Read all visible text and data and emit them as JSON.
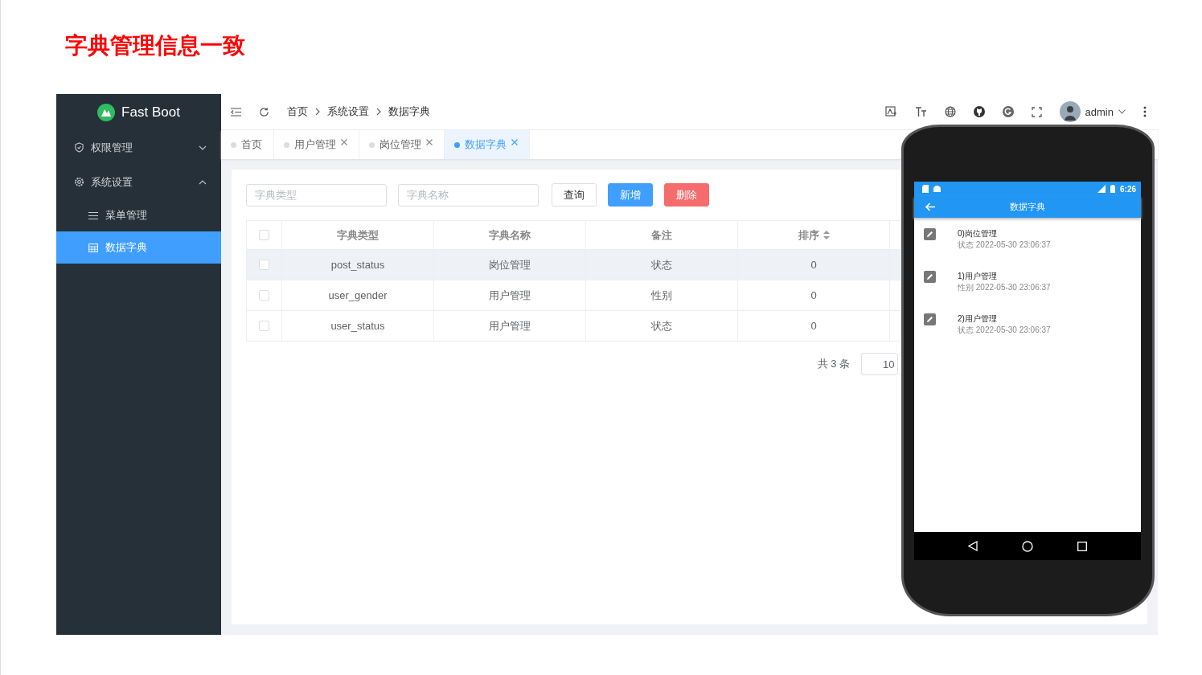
{
  "slide_title": "字典管理信息一致",
  "app": {
    "logo": "Fast Boot",
    "sidebar": [
      {
        "label": "权限管理",
        "expanded": false
      },
      {
        "label": "系统设置",
        "expanded": true,
        "children": [
          {
            "label": "菜单管理",
            "selected": false
          },
          {
            "label": "数据字典",
            "selected": true
          }
        ]
      }
    ],
    "breadcrumb": [
      "首页",
      "系统设置",
      "数据字典"
    ],
    "user": "admin",
    "tabs": [
      {
        "label": "首页",
        "selected": false,
        "closable": false
      },
      {
        "label": "用户管理",
        "selected": false,
        "closable": true
      },
      {
        "label": "岗位管理",
        "selected": false,
        "closable": true
      },
      {
        "label": "数据字典",
        "selected": true,
        "closable": true
      }
    ],
    "filters": [
      {
        "placeholder": "字典类型"
      },
      {
        "placeholder": "字典名称"
      }
    ],
    "buttons": [
      {
        "label": "查询",
        "kind": "default"
      },
      {
        "label": "新增",
        "kind": "primary"
      },
      {
        "label": "删除",
        "kind": "danger"
      }
    ],
    "table": {
      "header_checked": false,
      "columns": [
        {
          "label": "字典类型",
          "sortable": false
        },
        {
          "label": "字典名称",
          "sortable": false
        },
        {
          "label": "备注",
          "sortable": false
        },
        {
          "label": "排序",
          "sortable": true
        }
      ],
      "rows": [
        {
          "checked": false,
          "hovered": true,
          "cells": [
            "post_status",
            "岗位管理",
            "状态",
            "0"
          ]
        },
        {
          "checked": false,
          "hovered": false,
          "cells": [
            "user_gender",
            "用户管理",
            "性别",
            "0"
          ]
        },
        {
          "checked": false,
          "hovered": false,
          "cells": [
            "user_status",
            "用户管理",
            "状态",
            "0"
          ]
        }
      ]
    },
    "pagination": {
      "total": "共 3 条",
      "page_size": "10"
    }
  },
  "phone": {
    "time": "6:26",
    "title": "数据字典",
    "items": [
      {
        "title": "0)岗位管理",
        "subtitle": "状态 2022-05-30 23:06:37"
      },
      {
        "title": "1)用户管理",
        "subtitle": "性别 2022-05-30 23:06:37"
      },
      {
        "title": "2)用户管理",
        "subtitle": "状态 2022-05-30 23:06:37"
      }
    ]
  }
}
